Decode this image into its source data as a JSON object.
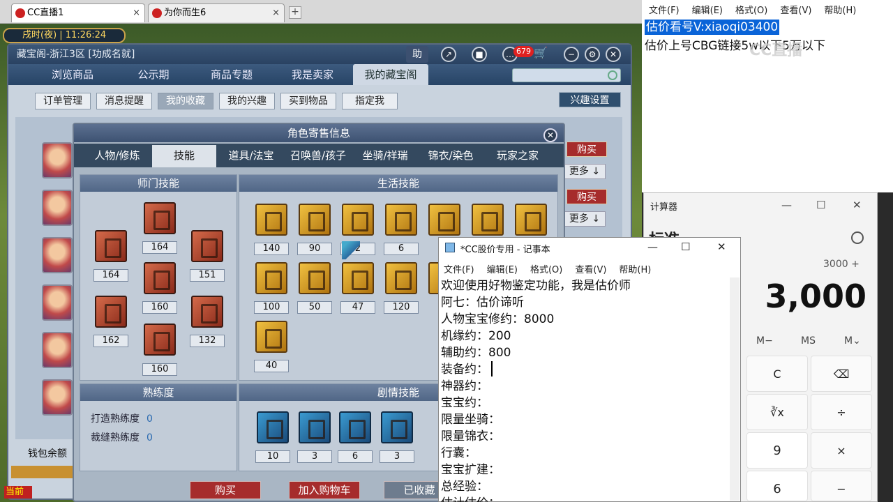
{
  "browser": {
    "tabs": [
      {
        "label": "CC直播1",
        "close": "×"
      },
      {
        "label": "为你而生6",
        "close": "×"
      }
    ],
    "add_tab": "+"
  },
  "game": {
    "time": "戌时(夜) | 11:26:24",
    "cbg_title": "藏宝阁-浙江3区 [功成名就]",
    "help": "助",
    "badge": "679",
    "nav_tabs": [
      "浏览商品",
      "公示期",
      "商品专题",
      "我是卖家",
      "我的藏宝阁"
    ],
    "sub_tabs": [
      "订单管理",
      "消息提醒",
      "我的收藏",
      "我的兴趣",
      "买到物品",
      "指定我"
    ],
    "interest_btn": "兴趣设置",
    "side_buy": "购买",
    "side_more": "更多 ↓",
    "wallet": "钱包余额",
    "current": "当前",
    "dialog": {
      "title": "角色寄售信息",
      "close": "✕",
      "tabs": [
        "人物/修炼",
        "技能",
        "道具/法宝",
        "召唤兽/孩子",
        "坐骑/祥瑞",
        "锦衣/染色",
        "玩家之家"
      ],
      "school_header": "师门技能",
      "life_header": "生活技能",
      "prof_header": "熟练度",
      "story_header": "剧情技能",
      "school_values": [
        "164",
        "164",
        "151",
        "160",
        "162",
        "132",
        "160"
      ],
      "life_values": [
        "140",
        "90",
        "2",
        "6",
        "100",
        "50",
        "47",
        "120",
        "40"
      ],
      "proficiency": [
        {
          "label": "打造熟练度",
          "value": "0"
        },
        {
          "label": "裁缝熟练度",
          "value": "0"
        }
      ],
      "story_values": [
        "10",
        "3",
        "6",
        "3"
      ],
      "buttons": [
        "购买",
        "加入购物车",
        "已收藏"
      ]
    }
  },
  "notepad1": {
    "menu": [
      "文件(F)",
      "编辑(E)",
      "格式(O)",
      "查看(V)",
      "帮助(H)"
    ],
    "line1": "估价看号V:xiaoqi03400",
    "line2": "估价上号CBG链接5w以下5万以下",
    "watermark": "CC直播"
  },
  "calculator": {
    "title": "计算器",
    "mode": "标准",
    "expression": "3000 +",
    "display": "3,000",
    "memory": [
      "M−",
      "MS",
      "M⌄"
    ],
    "keys": [
      [
        "C",
        "⌫"
      ],
      [
        "∛x",
        "÷"
      ],
      [
        "9",
        "×"
      ],
      [
        "6",
        "−"
      ]
    ]
  },
  "notepad2": {
    "title": "*CC股价专用 - 记事本",
    "menu": [
      "文件(F)",
      "编辑(E)",
      "格式(O)",
      "查看(V)",
      "帮助(H)"
    ],
    "lines": [
      "欢迎使用好物鉴定功能，我是估价师",
      "阿七：估价谛听",
      "人物宝宝修约：8000",
      "机缘约：200",
      "辅助约：800",
      "装备约：",
      "神器约：",
      "宝宝约：",
      "限量坐骑：",
      "限量锦衣：",
      "行囊：",
      "宝宝扩建：",
      "总经验：",
      "估计估价："
    ]
  }
}
